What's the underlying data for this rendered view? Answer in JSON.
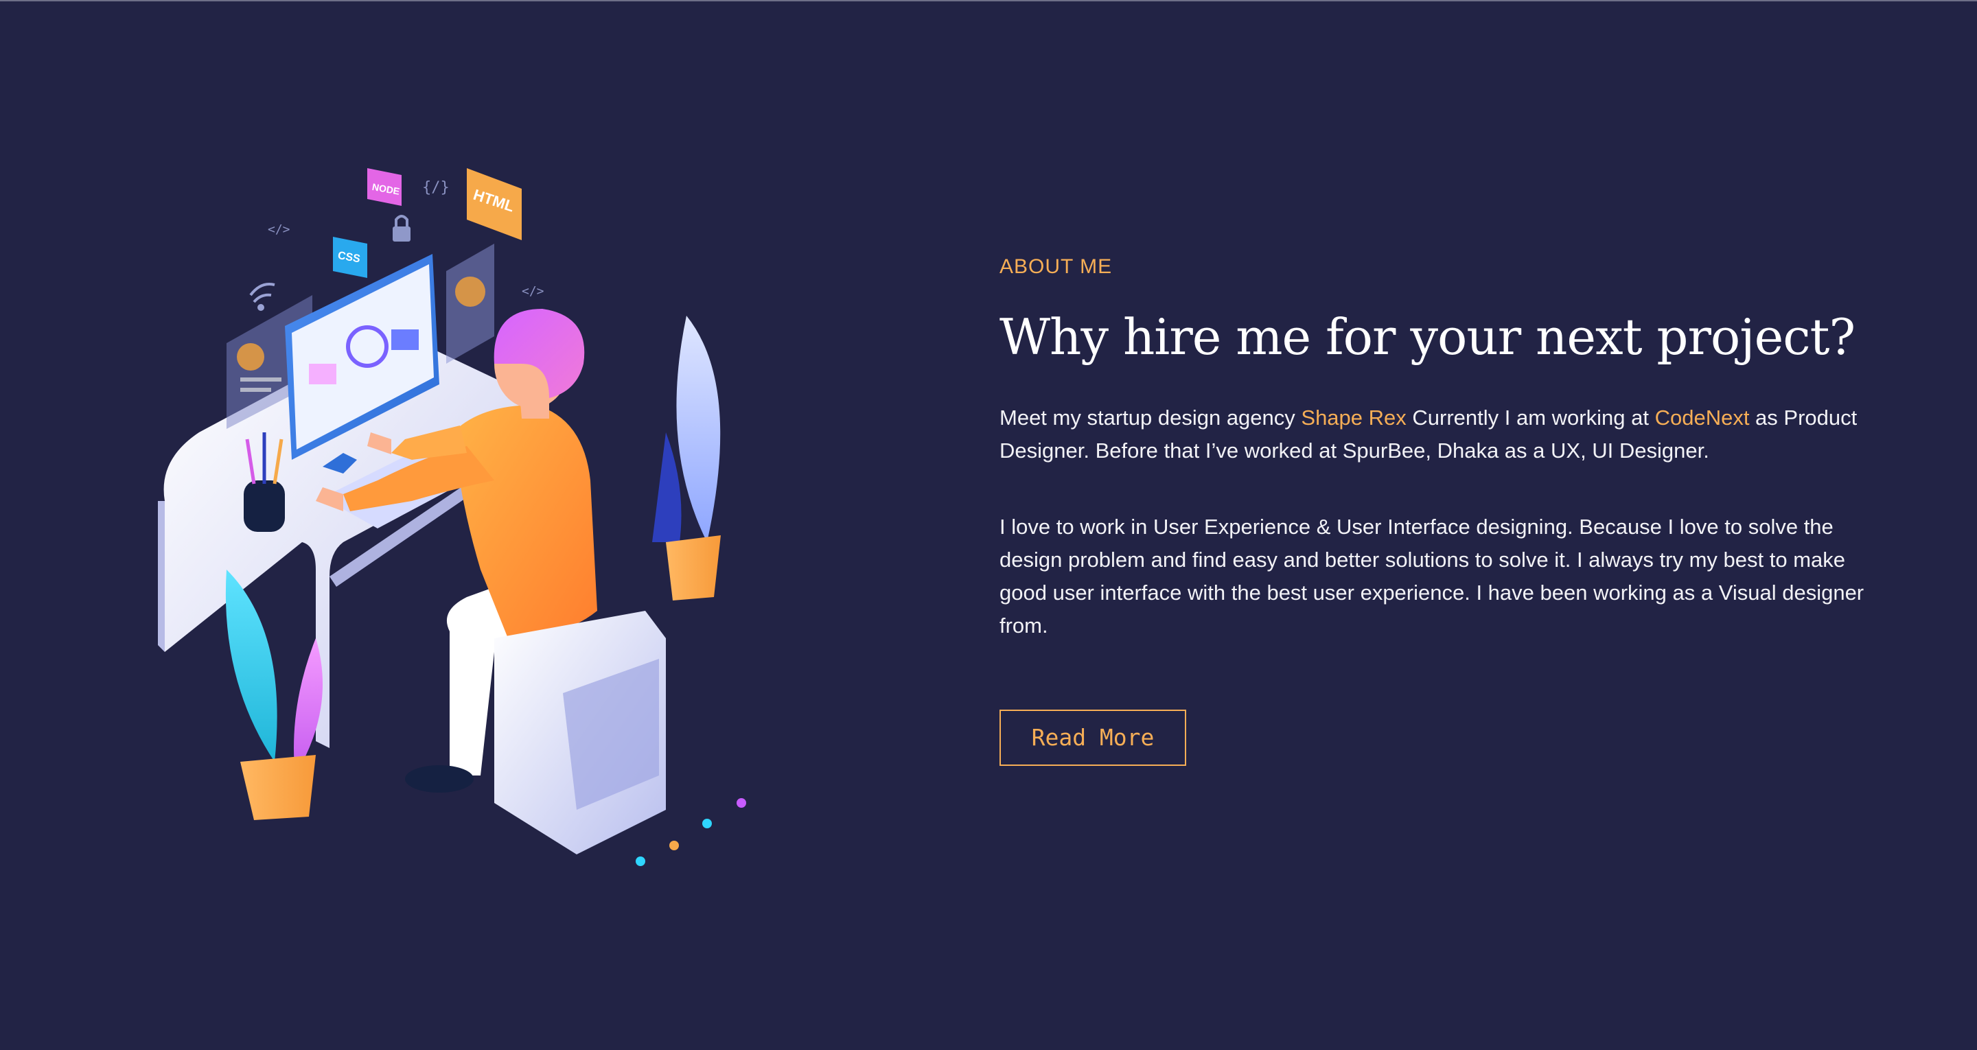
{
  "about": {
    "eyebrow": "ABOUT ME",
    "heading": "Why hire me for your next project?",
    "paragraph1": {
      "part1": "Meet my startup design agency ",
      "link1": "Shape Rex",
      "part2": " Currently I am working at ",
      "link2": "CodeNext",
      "part3": " as Product Designer. Before that I’ve worked at SpurBee, Dhaka as a UX, UI Designer."
    },
    "paragraph2": "I love to work in User Experience & User Interface designing. Because I love to solve the design problem and find easy and better solutions to solve it. I always try my best to make good user interface with the best user experience. I have been working as a Visual designer from.",
    "button_label": "Read More"
  },
  "illustration": {
    "tags": {
      "node": "NODE",
      "html": "HTML",
      "css": "CSS",
      "code1": "</>",
      "code2": "{/}",
      "code3": "</>"
    }
  },
  "colors": {
    "background": "#222345",
    "accent": "#f6ae56",
    "text": "#f2f2f6",
    "heading": "#ffffff"
  }
}
